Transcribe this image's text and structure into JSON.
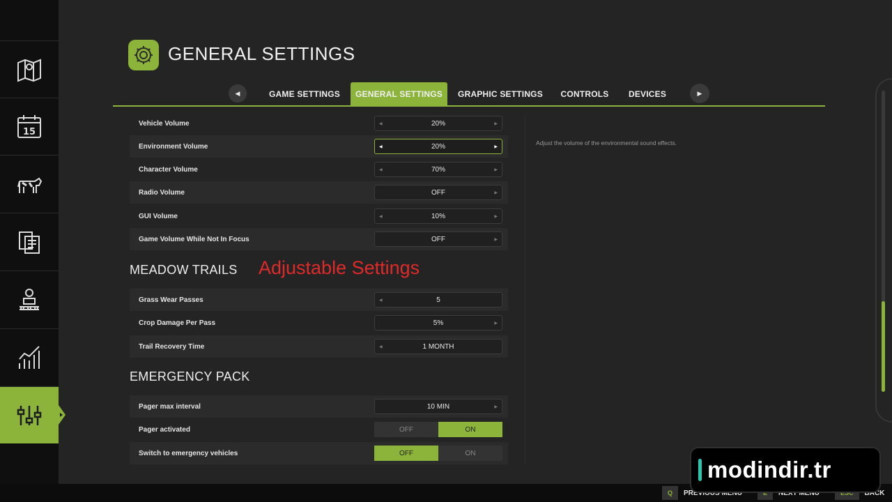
{
  "header": {
    "title": "GENERAL SETTINGS"
  },
  "tabs": [
    {
      "label": "GAME SETTINGS"
    },
    {
      "label": "GENERAL SETTINGS"
    },
    {
      "label": "GRAPHIC SETTINGS"
    },
    {
      "label": "CONTROLS"
    },
    {
      "label": "DEVICES"
    }
  ],
  "audio_settings": [
    {
      "label": "Vehicle Volume",
      "value": "20%"
    },
    {
      "label": "Environment Volume",
      "value": "20%"
    },
    {
      "label": "Character Volume",
      "value": "70%"
    },
    {
      "label": "Radio Volume",
      "value": "OFF"
    },
    {
      "label": "GUI Volume",
      "value": "10%"
    },
    {
      "label": "Game Volume While Not In Focus",
      "value": "OFF"
    }
  ],
  "meadow_trails": {
    "title": "MEADOW TRAILS",
    "annotation": "Adjustable Settings",
    "items": [
      {
        "label": "Grass Wear Passes",
        "value": "5"
      },
      {
        "label": "Crop Damage Per Pass",
        "value": "5%"
      },
      {
        "label": "Trail Recovery Time",
        "value": "1 MONTH"
      }
    ]
  },
  "emergency_pack": {
    "title": "EMERGENCY PACK",
    "pager_interval": {
      "label": "Pager max interval",
      "value": "10 MIN"
    },
    "pager_activated": {
      "label": "Pager activated",
      "off": "OFF",
      "on": "ON",
      "selected": "ON"
    },
    "switch_vehicles": {
      "label": "Switch to emergency vehicles",
      "off": "OFF",
      "on": "ON",
      "selected": "OFF"
    }
  },
  "description": "Adjust the volume of the environmental sound effects.",
  "sidebar": {
    "icons": [
      "map-icon",
      "calendar-icon",
      "cow-icon",
      "contracts-icon",
      "production-icon",
      "statistics-icon",
      "settings-icon"
    ],
    "calendar_day": "15",
    "active_index": 6
  },
  "scroll": {
    "position": 0.7
  },
  "footer": {
    "prev": {
      "key": "Q",
      "label": "PREVIOUS MENU"
    },
    "next": {
      "key": "E",
      "label": "NEXT MENU"
    },
    "back": {
      "key": "ESC",
      "label": "BACK"
    }
  },
  "watermark": "modindir.tr",
  "colors": {
    "accent": "#8cb43a",
    "annotation": "#e02a2a",
    "background": "#242424"
  }
}
